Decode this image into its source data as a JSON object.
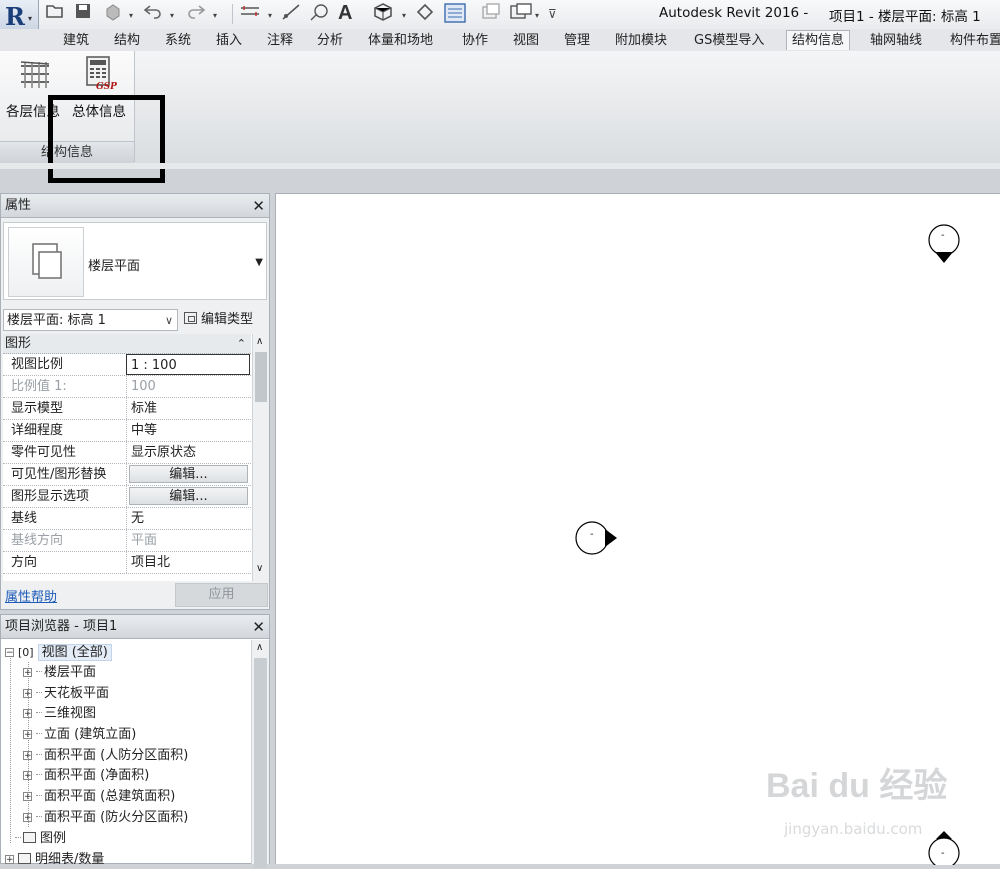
{
  "titlebar": {
    "app_title": "Autodesk Revit 2016 -",
    "doc_title": "项目1 - 楼层平面: 标高 1",
    "quick_access_icons": [
      "open-icon",
      "save-icon",
      "sync-icon",
      "undo-icon",
      "redo-icon",
      "measure-icon",
      "dimension-icon",
      "tag-icon",
      "text-icon",
      "3d-view-icon",
      "section-icon",
      "thin-lines-icon",
      "close-hidden-icon",
      "switch-windows-icon",
      "customize-icon"
    ]
  },
  "ribbon": {
    "tabs": [
      "建筑",
      "结构",
      "系统",
      "插入",
      "注释",
      "分析",
      "体量和场地",
      "协作",
      "视图",
      "管理",
      "附加模块",
      "GS模型导入",
      "结构信息",
      "轴网轴线",
      "构件布置"
    ],
    "active_tab": "结构信息",
    "panel": {
      "title": "结构信息",
      "buttons": [
        {
          "label": "各层信息",
          "icon": "floors-icon"
        },
        {
          "label": "总体信息",
          "icon": "gsp-table-icon",
          "icon_text": "GSP"
        }
      ]
    }
  },
  "properties": {
    "title": "属性",
    "type_name": "楼层平面",
    "instance": "楼层平面: 标高 1",
    "edit_type": "编辑类型",
    "group": "图形",
    "rows": [
      {
        "name": "视图比例",
        "value": "1 : 100"
      },
      {
        "name": "比例值 1:",
        "value": "100"
      },
      {
        "name": "显示模型",
        "value": "标准"
      },
      {
        "name": "详细程度",
        "value": "中等"
      },
      {
        "name": "零件可见性",
        "value": "显示原状态"
      },
      {
        "name": "可见性/图形替换",
        "value": "编辑..."
      },
      {
        "name": "图形显示选项",
        "value": "编辑..."
      },
      {
        "name": "基线",
        "value": "无"
      },
      {
        "name": "基线方向",
        "value": "平面"
      },
      {
        "name": "方向",
        "value": "项目北"
      }
    ],
    "help_link": "属性帮助",
    "apply": "应用"
  },
  "browser": {
    "title": "项目浏览器 - 项目1",
    "root": "视图 (全部)",
    "views": [
      "楼层平面",
      "天花板平面",
      "三维视图",
      "立面 (建筑立面)",
      "面积平面 (人防分区面积)",
      "面积平面 (净面积)",
      "面积平面 (总建筑面积)",
      "面积平面 (防火分区面积)"
    ],
    "legends": "图例",
    "schedules": "明细表/数量"
  },
  "canvas": {
    "elevation_marker_label": "-",
    "watermark": "Bai du 经验",
    "watermark_sub": "jingyan.baidu.com"
  }
}
